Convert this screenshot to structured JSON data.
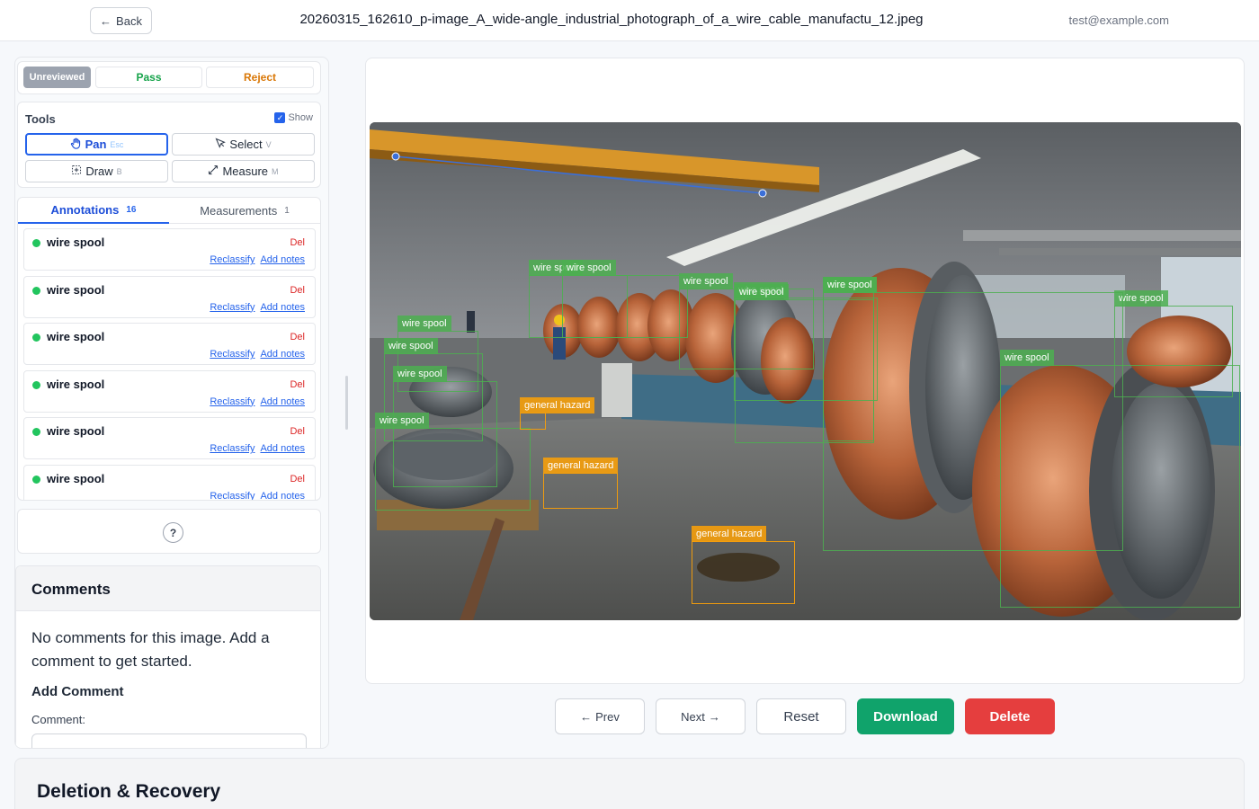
{
  "header": {
    "back_label": "Back",
    "filename": "20260315_162610_p-image_A_wide-angle_industrial_photograph_of_a_wire_cable_manufactu_12.jpeg",
    "user_email": "test@example.com"
  },
  "status": {
    "unreviewed": "Unreviewed",
    "pass": "Pass",
    "reject": "Reject"
  },
  "tools": {
    "title": "Tools",
    "show_label": "Show",
    "show_checked": true,
    "pan": {
      "label": "Pan",
      "key": "Esc"
    },
    "select": {
      "label": "Select",
      "key": "V"
    },
    "draw": {
      "label": "Draw",
      "key": "B"
    },
    "measure": {
      "label": "Measure",
      "key": "M"
    }
  },
  "tabs": {
    "annotations": {
      "label": "Annotations",
      "count": "16"
    },
    "measurements": {
      "label": "Measurements",
      "count": "1"
    }
  },
  "annotation_list": [
    {
      "label": "wire spool",
      "del": "Del",
      "reclassify": "Reclassify",
      "add_notes": "Add notes"
    },
    {
      "label": "wire spool",
      "del": "Del",
      "reclassify": "Reclassify",
      "add_notes": "Add notes"
    },
    {
      "label": "wire spool",
      "del": "Del",
      "reclassify": "Reclassify",
      "add_notes": "Add notes"
    },
    {
      "label": "wire spool",
      "del": "Del",
      "reclassify": "Reclassify",
      "add_notes": "Add notes"
    },
    {
      "label": "wire spool",
      "del": "Del",
      "reclassify": "Reclassify",
      "add_notes": "Add notes"
    },
    {
      "label": "wire spool",
      "del": "Del",
      "reclassify": "Reclassify",
      "add_notes": "Add notes"
    }
  ],
  "help": {
    "label": "?"
  },
  "comments": {
    "title": "Comments",
    "empty_text": "No comments for this image. Add a comment to get started.",
    "add_title": "Add Comment",
    "field_label": "Comment:"
  },
  "canvas_labels": [
    "wire spool",
    "wire spool",
    "wire spool",
    "wire spool",
    "wire spool",
    "wire spool",
    "wire spool",
    "wire spool",
    "wire spool",
    "wire spool",
    "wire spool",
    "wire spool",
    "wire spool",
    "general hazard",
    "general hazard",
    "general hazard"
  ],
  "colors": {
    "spool": "#4caf50",
    "hazard": "#f59e0b",
    "measure_line": "#3b6fd8",
    "download": "#10a36b",
    "delete": "#e53e3e",
    "accent": "#2563eb"
  },
  "actions": {
    "prev": "Prev",
    "next": "Next",
    "reset": "Reset",
    "download": "Download",
    "delete": "Delete"
  },
  "recovery": {
    "title": "Deletion & Recovery"
  }
}
